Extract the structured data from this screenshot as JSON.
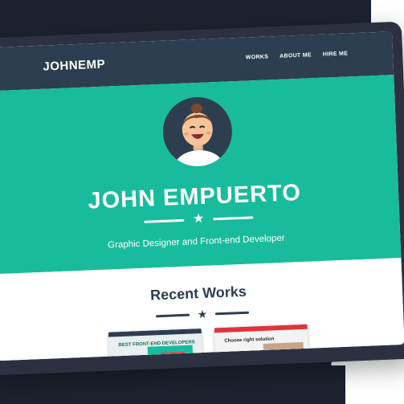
{
  "nav": {
    "logo": "JOHNEMP",
    "links": [
      "WORKS",
      "ABOUT ME",
      "HIRE ME"
    ]
  },
  "hero": {
    "name": "JOHN EMPUERTO",
    "tagline": "Graphic Designer and Front-end Developer"
  },
  "works": {
    "title": "Recent Works",
    "thumbnails": [
      {
        "label": "BEST FRONT-END DEVELOPERS"
      },
      {
        "label": "Choose right solution"
      }
    ]
  },
  "colors": {
    "primary": "#18bc9c",
    "nav": "#2c3e50",
    "device": "#2b3140",
    "background_dark": "#1d2230"
  },
  "icons": [
    "avatar-illustration",
    "star-icon"
  ]
}
